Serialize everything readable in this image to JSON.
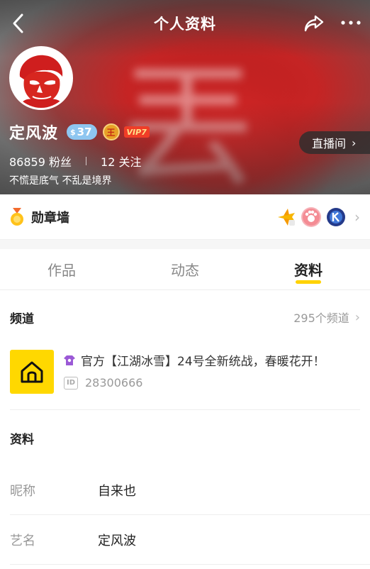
{
  "nav": {
    "title": "个人资料"
  },
  "profile": {
    "name": "定风波",
    "level": "37",
    "noble_badge": "王",
    "vip_label": "VIP7",
    "fans_count": "86859",
    "fans_label": "粉丝",
    "follow_count": "12",
    "follow_label": "关注",
    "bio": "不慌是底气 不乱是境界",
    "live_button": "直播间"
  },
  "medals": {
    "title": "勋章墙",
    "items": [
      "plane-medal",
      "paw-medal",
      "k-medal"
    ]
  },
  "tabs": [
    {
      "label": "作品",
      "active": false
    },
    {
      "label": "动态",
      "active": false
    },
    {
      "label": "资料",
      "active": true
    }
  ],
  "channels": {
    "title": "频道",
    "more": "295个频道",
    "item": {
      "title": "官方【江湖冰雪】24号全新统战，春暖花开！",
      "id_icon": "ID",
      "id": "28300666"
    }
  },
  "info": {
    "title": "资料",
    "rows": [
      {
        "label": "昵称",
        "value": "自来也"
      },
      {
        "label": "艺名",
        "value": "定风波"
      }
    ]
  },
  "colors": {
    "accent": "#ffd200",
    "live_bg": "#2d2d2d",
    "vip": "#f03d27",
    "level": "#8ec6f0"
  }
}
